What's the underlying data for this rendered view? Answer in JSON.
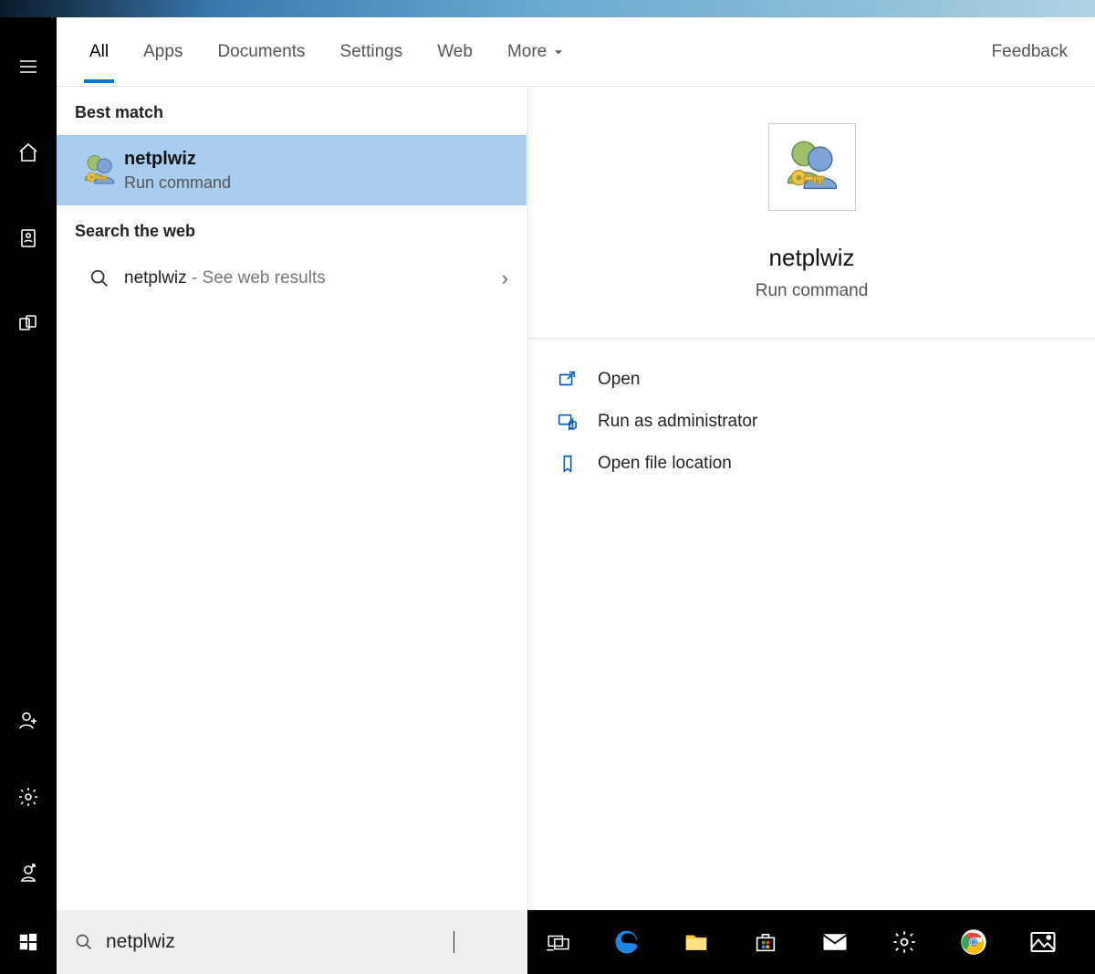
{
  "tabs": [
    "All",
    "Apps",
    "Documents",
    "Settings",
    "Web",
    "More"
  ],
  "active_tab_index": 0,
  "feedback_label": "Feedback",
  "sections": {
    "best_match_label": "Best match",
    "web_label": "Search the web"
  },
  "best_match": {
    "title": "netplwiz",
    "subtitle": "Run command"
  },
  "web_result": {
    "query": "netplwiz",
    "hint": " - See web results"
  },
  "preview": {
    "title": "netplwiz",
    "subtitle": "Run command",
    "actions": [
      "Open",
      "Run as administrator",
      "Open file location"
    ]
  },
  "search_input": {
    "value": "netplwiz"
  }
}
